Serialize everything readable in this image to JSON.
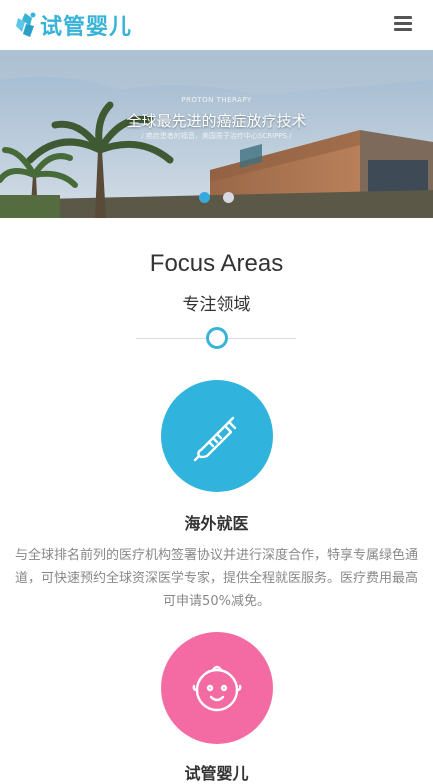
{
  "header": {
    "logo_text": "试管婴儿",
    "menu_icon": "hamburger-menu-icon"
  },
  "banner": {
    "small_caption": "PROTON THERAPY",
    "title": "全球最先进的癌症放疗技术",
    "subtitle": "/ 癌症患者的福音，美国质子治疗中心SCRIPPS /",
    "active_slide": 1,
    "slide_count": 2
  },
  "focus": {
    "title": "Focus Areas",
    "subtitle": "专注领域"
  },
  "services": [
    {
      "icon": "thermometer-icon",
      "title": "海外就医",
      "description": "与全球排名前列的医疗机构签署协议并进行深度合作，特享专属绿色通道，可快速预约全球资深医学专家，提供全程就医服务。医疗费用最高可申请50%减免。"
    },
    {
      "icon": "baby-face-icon",
      "title": "试管婴儿"
    }
  ],
  "colors": {
    "accent_blue": "#38b3d8",
    "service_blue": "#30b3dc",
    "service_pink": "#f36ba2"
  }
}
